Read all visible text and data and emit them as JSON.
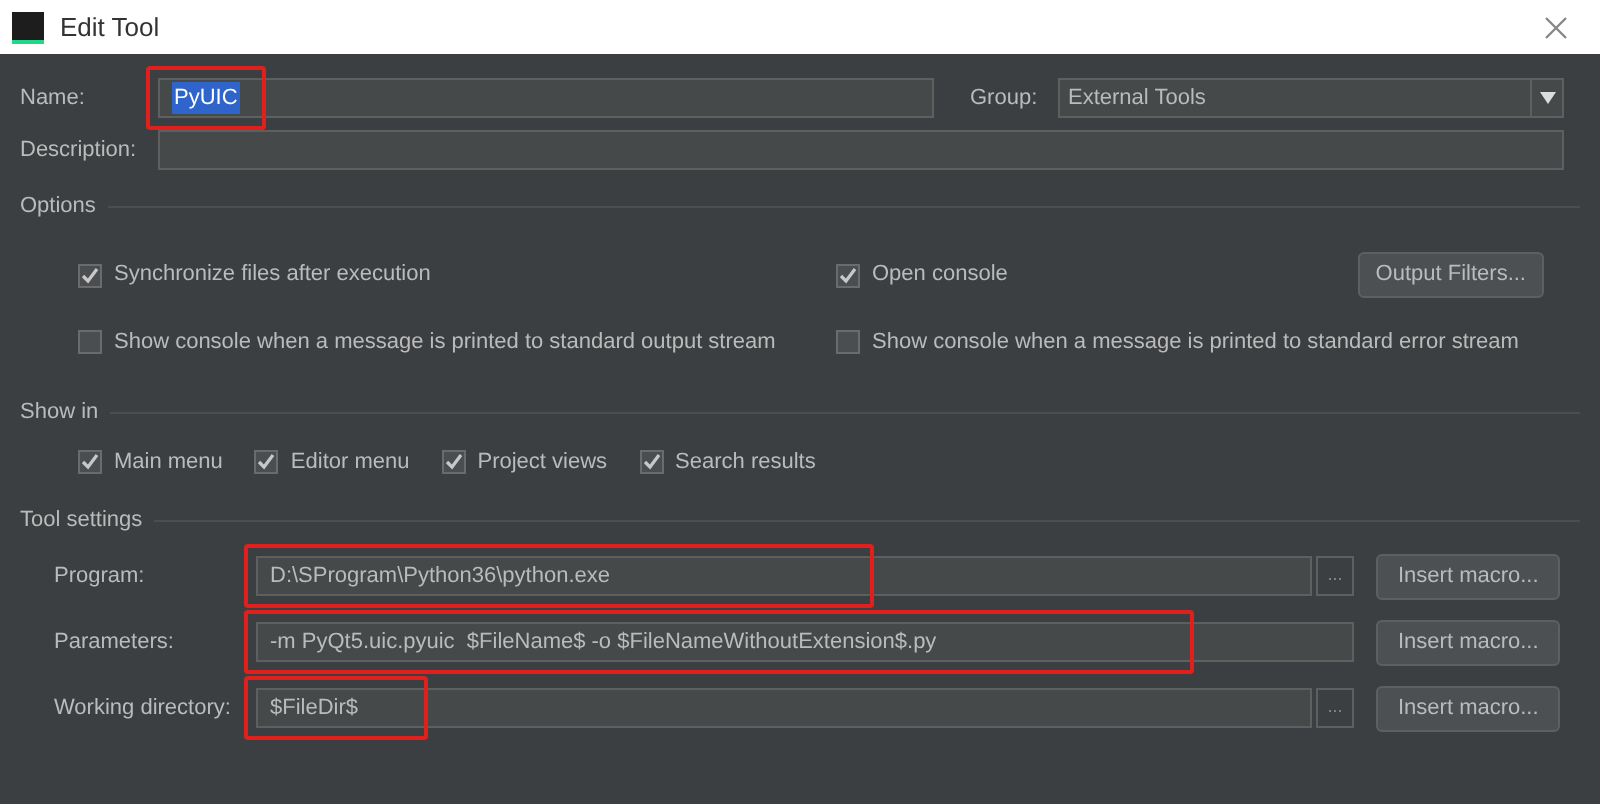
{
  "window": {
    "title": "Edit Tool"
  },
  "name_field": {
    "label": "Name:",
    "value": "PyUIC",
    "text_selected": true,
    "highlighted": true
  },
  "group": {
    "label": "Group:",
    "value": "External Tools"
  },
  "description": {
    "label": "Description:"
  },
  "options": {
    "title": "Options",
    "items": [
      {
        "label": "Synchronize files after execution",
        "checked": true
      },
      {
        "label": "Open console",
        "checked": true
      },
      {
        "label": "Show console when a message is printed to standard output stream",
        "checked": false
      },
      {
        "label": "Show console when a message is printed to standard error stream",
        "checked": false
      }
    ],
    "button": "Output Filters..."
  },
  "show_in": {
    "title": "Show in",
    "items": [
      {
        "label": "Main menu",
        "checked": true
      },
      {
        "label": "Editor menu",
        "checked": true
      },
      {
        "label": "Project views",
        "checked": true
      },
      {
        "label": "Search results",
        "checked": true
      }
    ]
  },
  "tool_settings": {
    "title": "Tool settings",
    "rows": [
      {
        "label": "Program:",
        "value": "D:\\SProgram\\Python36\\python.exe",
        "browse": "...",
        "button": "Insert macro...",
        "highlighted": true
      },
      {
        "label": "Parameters:",
        "value": "-m PyQt5.uic.pyuic  $FileName$ -o $FileNameWithoutExtension$.py",
        "button": "Insert macro...",
        "highlighted": true
      },
      {
        "label": "Working directory:",
        "value": "$FileDir$",
        "browse": "...",
        "button": "Insert macro...",
        "highlighted": true
      }
    ]
  }
}
